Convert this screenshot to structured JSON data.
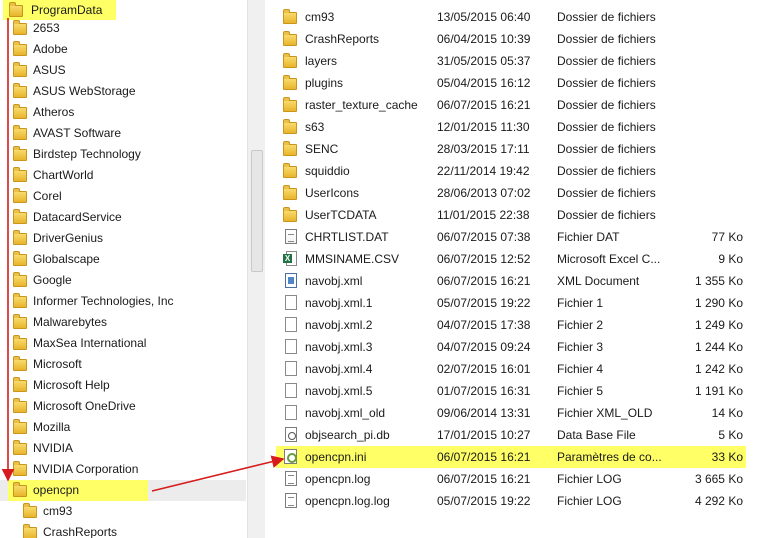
{
  "tree": {
    "items": [
      {
        "label": "ProgramData",
        "highlight": true
      },
      {
        "label": "2653"
      },
      {
        "label": "Adobe"
      },
      {
        "label": "ASUS"
      },
      {
        "label": "ASUS WebStorage"
      },
      {
        "label": "Atheros"
      },
      {
        "label": "AVAST Software"
      },
      {
        "label": "Birdstep Technology"
      },
      {
        "label": "ChartWorld"
      },
      {
        "label": "Corel"
      },
      {
        "label": "DatacardService"
      },
      {
        "label": "DriverGenius"
      },
      {
        "label": "Globalscape"
      },
      {
        "label": "Google"
      },
      {
        "label": "Informer Technologies, Inc"
      },
      {
        "label": "Malwarebytes"
      },
      {
        "label": "MaxSea International"
      },
      {
        "label": "Microsoft"
      },
      {
        "label": "Microsoft Help"
      },
      {
        "label": "Microsoft OneDrive"
      },
      {
        "label": "Mozilla"
      },
      {
        "label": "NVIDIA"
      },
      {
        "label": "NVIDIA Corporation"
      },
      {
        "label": "opencpn",
        "highlight": true
      },
      {
        "label": "cm93"
      },
      {
        "label": "CrashReports"
      }
    ]
  },
  "files": {
    "rows": [
      {
        "name": "cm93",
        "date": "13/05/2015 06:40",
        "type": "Dossier de fichiers",
        "size": "",
        "icon": "folder-icon"
      },
      {
        "name": "CrashReports",
        "date": "06/04/2015 10:39",
        "type": "Dossier de fichiers",
        "size": "",
        "icon": "folder-icon"
      },
      {
        "name": "layers",
        "date": "31/05/2015 05:37",
        "type": "Dossier de fichiers",
        "size": "",
        "icon": "folder-icon"
      },
      {
        "name": "plugins",
        "date": "05/04/2015 16:12",
        "type": "Dossier de fichiers",
        "size": "",
        "icon": "folder-icon"
      },
      {
        "name": "raster_texture_cache",
        "date": "06/07/2015 16:21",
        "type": "Dossier de fichiers",
        "size": "",
        "icon": "folder-icon"
      },
      {
        "name": "s63",
        "date": "12/01/2015 11:30",
        "type": "Dossier de fichiers",
        "size": "",
        "icon": "folder-icon"
      },
      {
        "name": "SENC",
        "date": "28/03/2015 17:11",
        "type": "Dossier de fichiers",
        "size": "",
        "icon": "folder-icon"
      },
      {
        "name": "squiddio",
        "date": "22/11/2014 19:42",
        "type": "Dossier de fichiers",
        "size": "",
        "icon": "folder-icon"
      },
      {
        "name": "UserIcons",
        "date": "28/06/2013 07:02",
        "type": "Dossier de fichiers",
        "size": "",
        "icon": "folder-icon"
      },
      {
        "name": "UserTCDATA",
        "date": "11/01/2015 22:38",
        "type": "Dossier de fichiers",
        "size": "",
        "icon": "folder-icon"
      },
      {
        "name": "CHRTLIST.DAT",
        "date": "06/07/2015 07:38",
        "type": "Fichier DAT",
        "size": "77 Ko",
        "icon": "dat-file-icon"
      },
      {
        "name": "MMSINAME.CSV",
        "date": "06/07/2015 12:52",
        "type": "Microsoft Excel C...",
        "size": "9 Ko",
        "icon": "excel-file-icon"
      },
      {
        "name": "navobj.xml",
        "date": "06/07/2015 16:21",
        "type": "XML Document",
        "size": "1 355 Ko",
        "icon": "xml-file-icon"
      },
      {
        "name": "navobj.xml.1",
        "date": "05/07/2015 19:22",
        "type": "Fichier 1",
        "size": "1 290 Ko",
        "icon": "file-icon"
      },
      {
        "name": "navobj.xml.2",
        "date": "04/07/2015 17:38",
        "type": "Fichier 2",
        "size": "1 249 Ko",
        "icon": "file-icon"
      },
      {
        "name": "navobj.xml.3",
        "date": "04/07/2015 09:24",
        "type": "Fichier 3",
        "size": "1 244 Ko",
        "icon": "file-icon"
      },
      {
        "name": "navobj.xml.4",
        "date": "02/07/2015 16:01",
        "type": "Fichier 4",
        "size": "1 242 Ko",
        "icon": "file-icon"
      },
      {
        "name": "navobj.xml.5",
        "date": "01/07/2015 16:31",
        "type": "Fichier 5",
        "size": "1 191 Ko",
        "icon": "file-icon"
      },
      {
        "name": "navobj.xml_old",
        "date": "09/06/2014 13:31",
        "type": "Fichier XML_OLD",
        "size": "14 Ko",
        "icon": "file-icon"
      },
      {
        "name": "objsearch_pi.db",
        "date": "17/01/2015 10:27",
        "type": "Data Base File",
        "size": "5 Ko",
        "icon": "db-file-icon"
      },
      {
        "name": "opencpn.ini",
        "date": "06/07/2015 16:21",
        "type": "Paramètres de co...",
        "size": "33 Ko",
        "icon": "ini-file-icon",
        "highlight": true
      },
      {
        "name": "opencpn.log",
        "date": "06/07/2015 16:21",
        "type": "Fichier LOG",
        "size": "3 665 Ko",
        "icon": "log-file-icon"
      },
      {
        "name": "opencpn.log.log",
        "date": "05/07/2015 19:22",
        "type": "Fichier LOG",
        "size": "4 292 Ko",
        "icon": "log-file-icon"
      }
    ]
  },
  "colors": {
    "highlight": "#ffff66",
    "arrow": "#d61c1c",
    "folder": "#e8b42c"
  }
}
